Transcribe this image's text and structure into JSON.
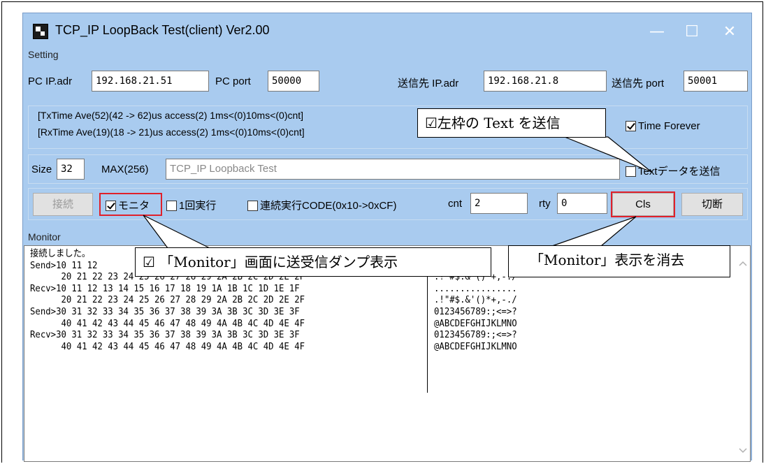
{
  "window": {
    "title": "TCP_IP LoopBack Test(client) Ver2.00",
    "minimize_glyph": "—",
    "maximize_glyph": "☐",
    "close_glyph": "✕"
  },
  "setting": {
    "group_label": "Setting",
    "pc_ip_label": "PC IP.adr",
    "pc_ip_value": "192.168.21.51",
    "pc_port_label": "PC port",
    "pc_port_value": "50000",
    "dest_ip_label": "送信先 IP.adr",
    "dest_ip_value": "192.168.21.8",
    "dest_port_label": "送信先 port",
    "dest_port_value": "50001"
  },
  "stats": {
    "tx": "[TxTime Ave(52)(42 -> 62)us access(2) 1ms<(0)10ms<(0)cnt]",
    "rx": "[RxTime Ave(19)(18 -> 21)us access(2) 1ms<(0)10ms<(0)cnt]",
    "time_forever_label": "Time Forever",
    "time_forever_checked": true
  },
  "text_row": {
    "size_label": "Size",
    "size_value": "32",
    "max_label": "MAX(256)",
    "text_value": "TCP_IP Loopback Test",
    "send_text_label": "Textデータを送信",
    "send_text_checked": false
  },
  "controls": {
    "connect_label": "接続",
    "monitor_label": "モニタ",
    "monitor_checked": true,
    "once_label": "1回実行",
    "once_checked": false,
    "continuous_label": "連続実行CODE(0x10->0xCF)",
    "continuous_checked": false,
    "cnt_label": "cnt",
    "cnt_value": "2",
    "rty_label": "rty",
    "rty_value": "0",
    "cls_label": "Cls",
    "disconnect_label": "切断"
  },
  "monitor": {
    "group_label": "Monitor",
    "hex_lines": [
      "接続しました。",
      "Send>10 11 12",
      "      20 21 22 23 24 25 26 27 28 29 2A 2B 2C 2D 2E 2F",
      "Recv>10 11 12 13 14 15 16 17 18 19 1A 1B 1C 1D 1E 1F",
      "      20 21 22 23 24 25 26 27 28 29 2A 2B 2C 2D 2E 2F",
      "Send>30 31 32 33 34 35 36 37 38 39 3A 3B 3C 3D 3E 3F",
      "      40 41 42 43 44 45 46 47 48 49 4A 4B 4C 4D 4E 4F",
      "Recv>30 31 32 33 34 35 36 37 38 39 3A 3B 3C 3D 3E 3F",
      "      40 41 42 43 44 45 46 47 48 49 4A 4B 4C 4D 4E 4F"
    ],
    "ascii_lines": [
      "",
      "",
      ".!\"#$.&'()*+,-./",
      "................",
      ".!\"#$.&'()*+,-./",
      "0123456789:;<=>?",
      "@ABCDEFGHIJKLMNO",
      "0123456789:;<=>?",
      "@ABCDEFGHIJKLMNO"
    ]
  },
  "callouts": {
    "send_text": "☑左枠の Text を送信",
    "monitor_dump": "☑ 「Monitor」画面に送受信ダンプ表示",
    "clear_monitor": "「Monitor」表示を消去"
  },
  "colors": {
    "window_bg": "#a9cbef",
    "highlight_red": "#e0202a"
  }
}
